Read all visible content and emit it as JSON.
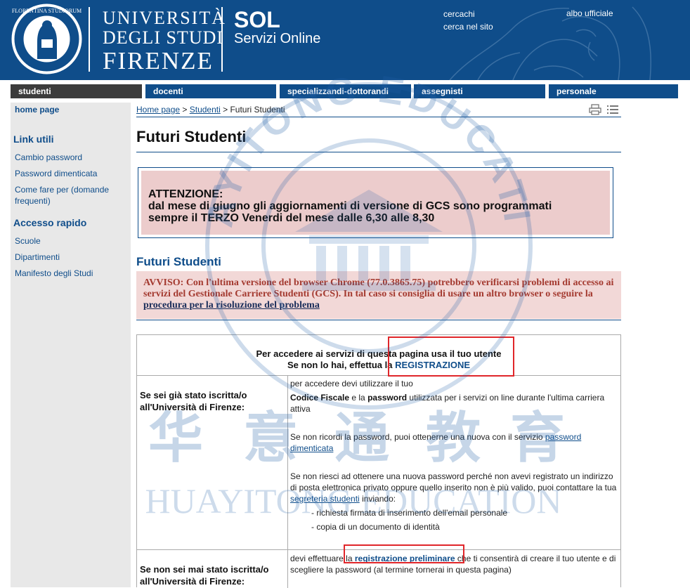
{
  "header": {
    "university_line1": "UNIVERSITÀ",
    "university_line2": "DEGLI STUDI",
    "university_line3": "FIRENZE",
    "sol_title": "SOL",
    "sol_subtitle": "Servizi Online",
    "link_cercachi": "cercachi",
    "link_cerca_sito": "cerca nel sito",
    "link_albo": "albo ufficiale"
  },
  "nav": [
    "studenti",
    "docenti",
    "specializzandi-dottorandi",
    "assegnisti",
    "personale"
  ],
  "sidebar": {
    "home": "home page",
    "link_utili_title": "Link utili",
    "link_utili": [
      "Cambio password",
      "Password dimenticata",
      "Come fare per (domande frequenti)"
    ],
    "accesso_title": "Accesso rapido",
    "accesso": [
      "Scuole",
      "Dipartimenti",
      "Manifesto degli Studi"
    ]
  },
  "breadcrumb": {
    "home": "Home page",
    "sep1": " > ",
    "studenti": "Studenti",
    "sep2": " > ",
    "current": "Futuri Studenti"
  },
  "page_title": "Futuri Studenti",
  "notice": {
    "line1": "ATTENZIONE:",
    "line2": "dal mese di giugno gli aggiornamenti di versione di GCS sono programmati",
    "line3": "sempre il TERZO Venerdi del mese dalle 6,30 alle 8,30"
  },
  "section_title": "Futuri Studenti",
  "avviso": {
    "text": "AVVISO: Con l'ultima versione del browser Chrome (77.0.3865.75) potrebbero verificarsi problemi di accesso ai servizi del Gestionale Carriere Studenti (GCS). In tal caso si consiglia di usare un altro browser o seguire la ",
    "link": "procedura per la risoluzione del problema"
  },
  "login": {
    "head_line1": "Per accedere ai servizi di questa pagina usa il tuo utente",
    "head_line2_pre": "Se non lo hai, effettua la ",
    "head_line2_link": "REGISTRAZIONE",
    "row1_label": "Se sei già stato iscritta/o all'Università di Firenze:",
    "row1_p1": "per accedere devi utilizzare il tuo",
    "row1_p2_b1": "Codice Fiscale",
    "row1_p2_mid": " e la ",
    "row1_p2_b2": "password",
    "row1_p2_rest": " utilizzata per i servizi on line durante l'ultima carriera attiva",
    "row1_p3_pre": "Se non ricordi la password,  puoi ottenerne una nuova con il servizio ",
    "row1_p3_link": "password dimenticata",
    "row1_p4_pre": "Se non riesci ad ottenere una nuova password perché non avevi registrato un indirizzo di posta elettronica privato oppure quello inserito non è più valido, puoi contattare la tua ",
    "row1_p4_link": "segreteria studenti",
    "row1_p4_post": " inviando:",
    "row1_bullet1": "- richiesta firmata di inserimento dell'email personale",
    "row1_bullet2": "- copia di un documento di identità",
    "row2_label": "Se non sei mai stato iscritta/o all'Università di Firenze:",
    "row2_pre": "devi effettuare la ",
    "row2_link": "registrazione preliminare",
    "row2_post": "  che ti consentirà di creare il tuo utente e di scegliere la password (al termine tornerai in questa pagina)"
  },
  "watermark": {
    "arc_text": "HUAYITONG EDUCATION",
    "cn": [
      "华",
      "意",
      "通",
      "教",
      "育"
    ],
    "en": "HUAYITONG EDUCATION"
  },
  "colors": {
    "brand_blue": "#0f4d8a",
    "nav_active": "#3c3c3c",
    "notice_bg": "#eccccc",
    "avviso_text": "#a43a30",
    "highlight_red": "#e0262a"
  }
}
